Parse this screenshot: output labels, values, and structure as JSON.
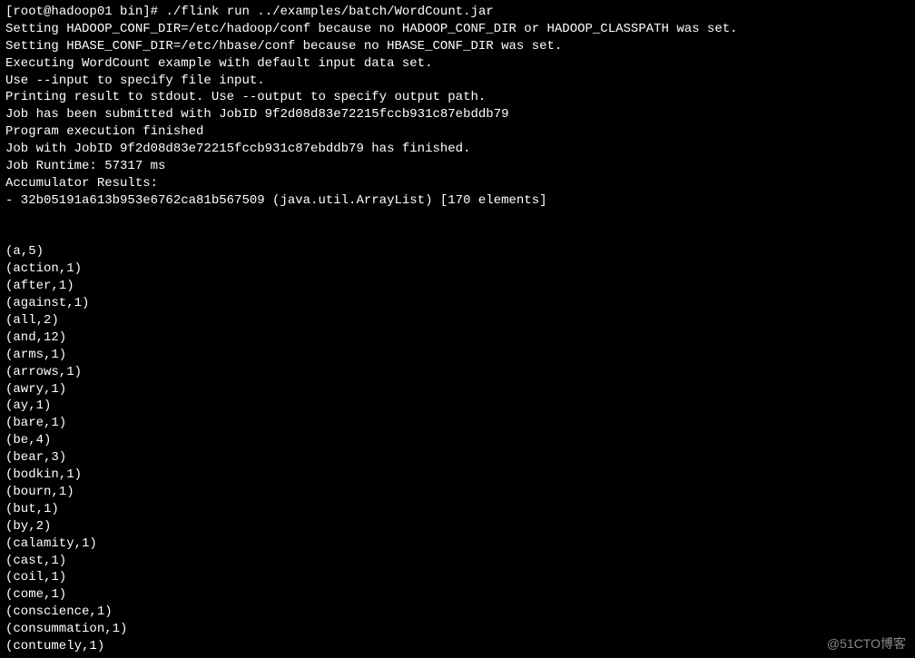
{
  "prompt": {
    "user": "root",
    "host": "hadoop01",
    "dir": "bin",
    "symbol": "#",
    "command": "./flink run ../examples/batch/WordCount.jar"
  },
  "messages": {
    "hadoop_conf": "Setting HADOOP_CONF_DIR=/etc/hadoop/conf because no HADOOP_CONF_DIR or HADOOP_CLASSPATH was set.",
    "hbase_conf": "Setting HBASE_CONF_DIR=/etc/hbase/conf because no HBASE_CONF_DIR was set.",
    "executing": "Executing WordCount example with default input data set.",
    "use_input": "Use --input to specify file input.",
    "printing": "Printing result to stdout. Use --output to specify output path.",
    "submitted": "Job has been submitted with JobID 9f2d08d83e72215fccb931c87ebddb79",
    "exec_finished": "Program execution finished",
    "finished": "Job with JobID 9f2d08d83e72215fccb931c87ebddb79 has finished.",
    "runtime": "Job Runtime: 57317 ms",
    "accum_header": "Accumulator Results:",
    "accum_line": "- 32b05191a613b953e6762ca81b567509 (java.util.ArrayList) [170 elements]"
  },
  "results": [
    "(a,5)",
    "(action,1)",
    "(after,1)",
    "(against,1)",
    "(all,2)",
    "(and,12)",
    "(arms,1)",
    "(arrows,1)",
    "(awry,1)",
    "(ay,1)",
    "(bare,1)",
    "(be,4)",
    "(bear,3)",
    "(bodkin,1)",
    "(bourn,1)",
    "(but,1)",
    "(by,2)",
    "(calamity,1)",
    "(cast,1)",
    "(coil,1)",
    "(come,1)",
    "(conscience,1)",
    "(consummation,1)",
    "(contumely,1)"
  ],
  "watermark": "@51CTO博客"
}
